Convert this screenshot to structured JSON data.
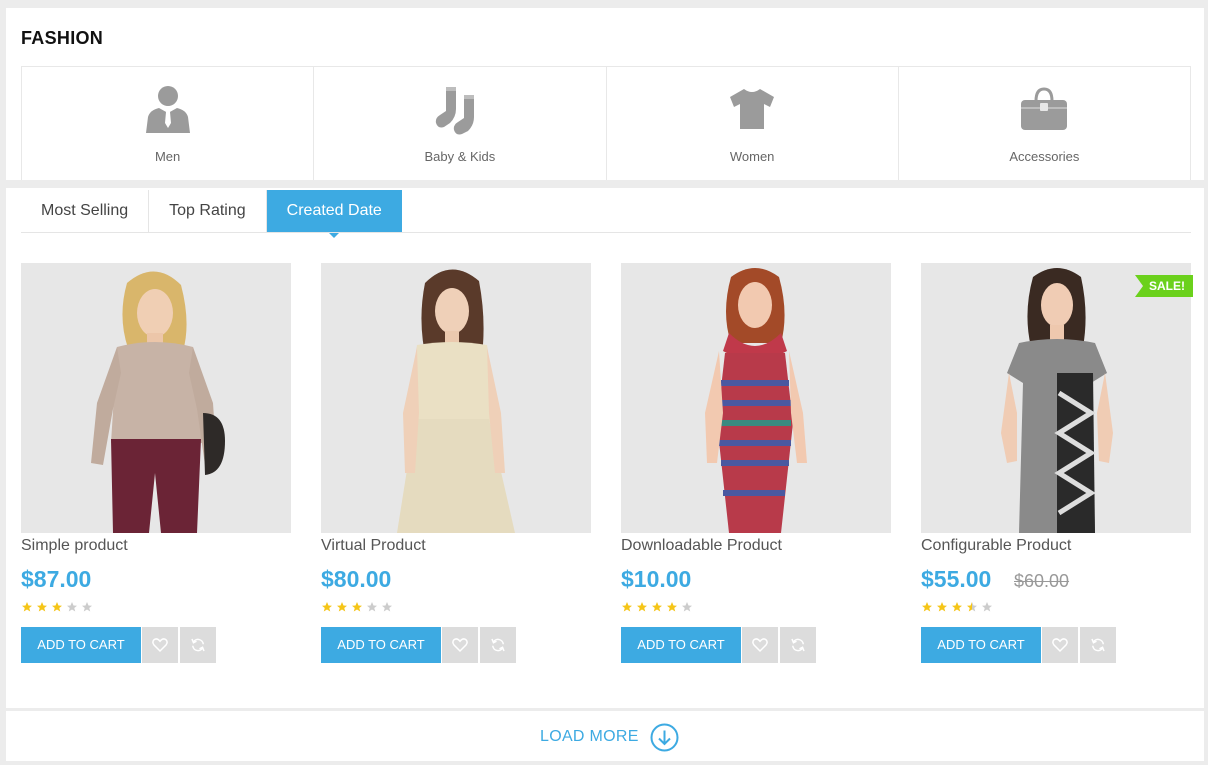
{
  "section": {
    "title": "FASHION"
  },
  "categories": [
    {
      "label": "Men",
      "icon": "man-icon"
    },
    {
      "label": "Baby & Kids",
      "icon": "socks-icon"
    },
    {
      "label": "Women",
      "icon": "tshirt-icon"
    },
    {
      "label": "Accessories",
      "icon": "handbag-icon"
    }
  ],
  "tabs": [
    {
      "label": "Most Selling",
      "active": false
    },
    {
      "label": "Top Rating",
      "active": false
    },
    {
      "label": "Created Date",
      "active": true
    }
  ],
  "products": [
    {
      "name": "Simple product",
      "price": "$87.00",
      "old_price": "",
      "rating": 3,
      "max_rating": 5,
      "sale_badge": "",
      "cart_label": "ADD TO CART"
    },
    {
      "name": "Virtual Product",
      "price": "$80.00",
      "old_price": "",
      "rating": 3,
      "max_rating": 5,
      "sale_badge": "",
      "cart_label": "ADD TO CART"
    },
    {
      "name": "Downloadable Product",
      "price": "$10.00",
      "old_price": "",
      "rating": 4,
      "max_rating": 5,
      "sale_badge": "",
      "cart_label": "ADD TO CART"
    },
    {
      "name": "Configurable Product",
      "price": "$55.00",
      "old_price": "$60.00",
      "rating": 3.5,
      "max_rating": 5,
      "sale_badge": "SALE!",
      "cart_label": "ADD TO CART"
    }
  ],
  "load_more": {
    "label": "LOAD MORE"
  },
  "colors": {
    "accent": "#3daae2",
    "sale": "#6bd11c",
    "star_on": "#f5c518",
    "star_off": "#cccccc",
    "icon_gray": "#9b9b9b"
  }
}
